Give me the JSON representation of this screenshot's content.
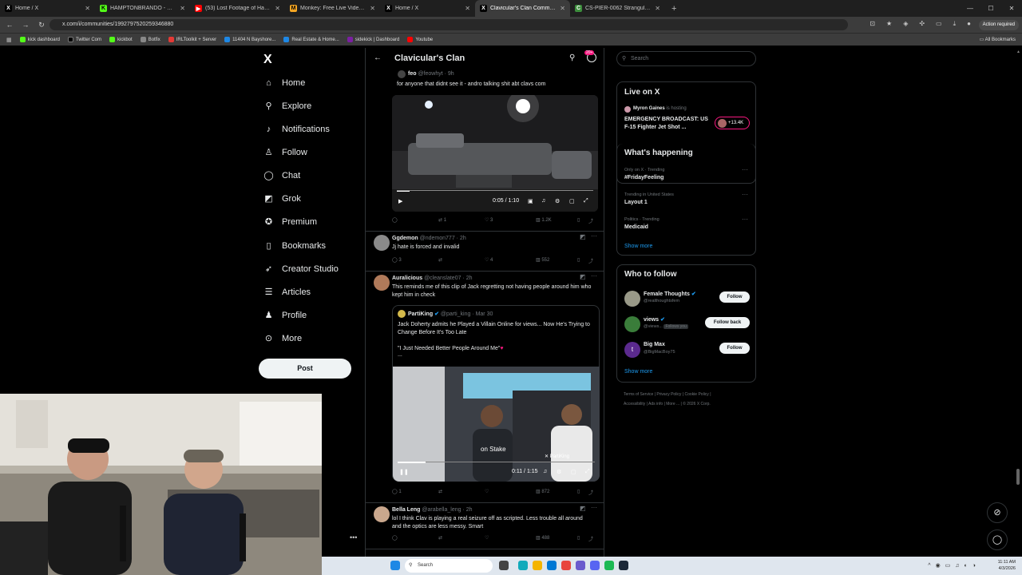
{
  "browser": {
    "tabs": [
      {
        "label": "Home / X",
        "fav": "X",
        "color": "#000"
      },
      {
        "label": "HAMPTONBRANDO - Watch th",
        "fav": "K",
        "color": "#53fc18"
      },
      {
        "label": "(53) Lost Footage of Hampton",
        "fav": "▶",
        "color": "#ff0000"
      },
      {
        "label": "Monkey: Free Live Video C",
        "fav": "M",
        "color": "#f5a623"
      },
      {
        "label": "Home / X",
        "fav": "X",
        "color": "#000"
      },
      {
        "label": "Clavicular's Clan Communi",
        "fav": "X",
        "color": "#000"
      },
      {
        "label": "CS-PIER-0062 Strangulation - s",
        "fav": "C",
        "color": "#3c8d3c"
      }
    ],
    "new_tab": "+",
    "url": "x.com/i/communities/1992797520259346880",
    "action_required": "Action required",
    "bookmarks": [
      {
        "label": "kick dashboard",
        "color": "#53fc18"
      },
      {
        "label": "Twitter Com",
        "color": "#000"
      },
      {
        "label": "kickbot",
        "color": "#53fc18"
      },
      {
        "label": "Botfix",
        "color": "#888"
      },
      {
        "label": "IRLToolkit + Server",
        "color": "#e53935"
      },
      {
        "label": "11404 N Bayshore...",
        "color": "#1e88e5"
      },
      {
        "label": "Real Estate & Home...",
        "color": "#1e88e5"
      },
      {
        "label": "sidekick | Dashboard",
        "color": "#7b1fa2"
      },
      {
        "label": "Youtube",
        "color": "#ff0000"
      }
    ],
    "all_bookmarks": "All Bookmarks"
  },
  "nav": {
    "logo": "X",
    "items": [
      {
        "label": "Home",
        "icon": "home-icon",
        "glyph": "⌂"
      },
      {
        "label": "Explore",
        "icon": "search-icon",
        "glyph": "⚲"
      },
      {
        "label": "Notifications",
        "icon": "bell-icon",
        "glyph": "♪"
      },
      {
        "label": "Follow",
        "icon": "add-person-icon",
        "glyph": "♙"
      },
      {
        "label": "Chat",
        "icon": "chat-icon",
        "glyph": "◯"
      },
      {
        "label": "Grok",
        "icon": "grok-icon",
        "glyph": "◩"
      },
      {
        "label": "Premium",
        "icon": "premium-icon",
        "glyph": "✪"
      },
      {
        "label": "Bookmarks",
        "icon": "bookmark-icon",
        "glyph": "▯"
      },
      {
        "label": "Creator Studio",
        "icon": "rocket-icon",
        "glyph": "➶"
      },
      {
        "label": "Articles",
        "icon": "article-icon",
        "glyph": "☰"
      },
      {
        "label": "Profile",
        "icon": "profile-icon",
        "glyph": "♟"
      },
      {
        "label": "More",
        "icon": "more-icon",
        "glyph": "⊙"
      }
    ],
    "post": "Post"
  },
  "header": {
    "title": "Clavicular's Clan",
    "badge": "20+"
  },
  "tweets": {
    "t0": {
      "name": "feo",
      "handle": "@feowhyt · 9h",
      "text": "for anyone that didnt see it - andro talking shit abt clavs com",
      "time": "0:05 / 1:10",
      "replies": "",
      "retweets": "1",
      "likes": "3",
      "views": "1.2K"
    },
    "t1": {
      "name": "Ggdemon",
      "handle": "@ndemon777 · 2h",
      "text": "Jj hate is forced and invalid",
      "replies": "3",
      "likes": "4",
      "views": "552"
    },
    "t2": {
      "name": "Auralicious",
      "handle": "@cleanslate07 · 2h",
      "text": "This reminds me of this clip of Jack regretting not having people around him who kept him in check",
      "quote_name": "PartiKing",
      "quote_handle": "@parti_king · Mar 30",
      "quote_text": "Jack Doherty admits he Played a Villain Online for views... Now He's Trying to Change Before It's Too Late",
      "quote_text2": "\"I Just Needed Better People Around Me\"",
      "quote_ellipsis": "...",
      "watermark": "PartiKing",
      "time": "0:11 / 1:15",
      "replies": "1",
      "views": "872"
    },
    "t3": {
      "name": "Bella Leng",
      "handle": "@arabella_leng · 2h",
      "text": "lol I think Clav is playing a real seizure off as scripted. Less trouble all around and the optics are less messy. Smart",
      "views": "488"
    }
  },
  "right": {
    "search_placeholder": "Search",
    "live": {
      "title": "Live on X",
      "host": "Myron Gaines",
      "host_suffix": "is hosting",
      "headline": "EMERGENCY BROADCAST: US F-15 Fighter Jet Shot ...",
      "count": "+13.4K"
    },
    "happening": {
      "title": "What's happening",
      "items": [
        {
          "meta": "Only on X · Trending",
          "topic": "#FridayFeeling"
        },
        {
          "meta": "Trending in United States",
          "topic": "Layout 1"
        },
        {
          "meta": "Politics · Trending",
          "topic": "Medicaid"
        }
      ],
      "show_more": "Show more"
    },
    "wtf": {
      "title": "Who to follow",
      "users": [
        {
          "name": "Female Thoughts",
          "handle": "@realthoughtsfem",
          "button": "Follow"
        },
        {
          "name": "views",
          "handle": "@views...",
          "extra": "Follows you",
          "button": "Follow back"
        },
        {
          "name": "Big Max",
          "handle": "@BigMacBoy75",
          "button": "Follow"
        }
      ],
      "show_more": "Show more"
    },
    "footer": [
      "Terms of Service",
      "Privacy Policy",
      "Cookie Policy",
      "Accessibility",
      "Ads info",
      "More ...",
      "© 2026 X Corp."
    ]
  },
  "taskbar": {
    "search": "Search",
    "time": "11:11 AM",
    "date": "4/3/2026"
  }
}
